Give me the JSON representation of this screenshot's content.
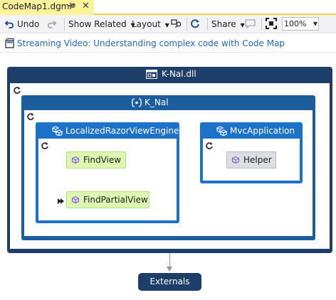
{
  "tab": {
    "title": "CodeMap1.dgml*",
    "pin_icon": "pin-icon",
    "close_glyph": "✕"
  },
  "toolbar": {
    "undo_label": "Undo",
    "show_related_label": "Show Related",
    "layout_label": "Layout",
    "share_label": "Share",
    "zoom_value": "100%"
  },
  "info": {
    "link_text": "Streaming Video: Understanding complex code with Code Map"
  },
  "map": {
    "assembly": {
      "label": "K-Nal.dll"
    },
    "namespace": {
      "label": "K_Nal"
    },
    "classes": [
      {
        "label": "LocalizedRazorViewEngine",
        "methods": [
          "FindView",
          "FindPartialView"
        ]
      },
      {
        "label": "MvcApplication",
        "methods": [
          "Helper"
        ]
      }
    ],
    "externals": {
      "label": "Externals"
    }
  },
  "colors": {
    "assembly": "#1d3e68",
    "namespace": "#1c5d9e",
    "class": "#1c72c9",
    "method_public": "#ddf6b1",
    "method_private": "#dcdee3",
    "tab_active": "#fff29d",
    "link": "#1e66b8"
  }
}
